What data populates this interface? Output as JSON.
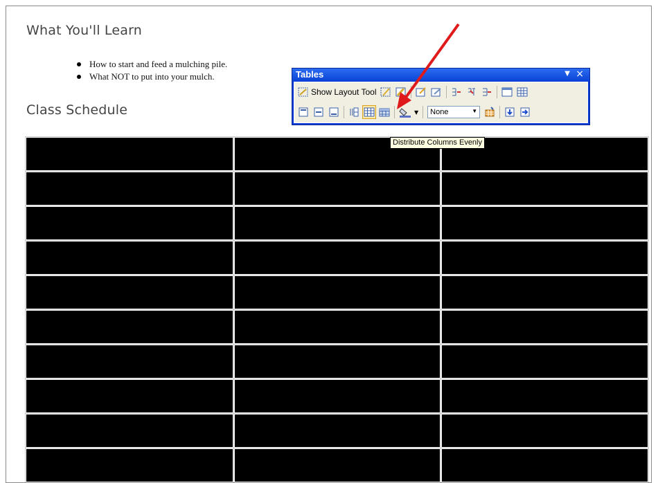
{
  "document": {
    "learn_heading": "What You'll Learn",
    "bullets": [
      "How to start and feed a mulching pile.",
      "What NOT to put into your mulch."
    ],
    "schedule_heading": "Class Schedule",
    "table": {
      "rows": 10,
      "columns": 3
    }
  },
  "toolbar": {
    "title": "Tables",
    "show_layout_tool_label": "Show Layout Tool",
    "style_dropdown_value": "None",
    "tooltip": "Distribute Columns Evenly"
  },
  "colors": {
    "toolbar_title": "#0b44d6",
    "toolbar_body": "#f1efe2",
    "table_cell": "#000000",
    "tooltip_bg": "#ffffe1",
    "annotation_arrow": "#e01a1a"
  },
  "icons": {
    "row1": [
      "draw-table-icon",
      "eraser-icon",
      "insert-table-icon",
      "cell-props-icon",
      "split-cells-icon",
      "merge-cells-icon",
      "insert-row-icon",
      "table-grid-icon"
    ],
    "row2": [
      "align-top-icon",
      "align-center-icon",
      "align-bottom-icon",
      "distribute-rows-icon",
      "distribute-columns-icon",
      "autofit-icon",
      "fill-color-icon",
      "table-autoformat-icon",
      "insert-rows-below-icon",
      "insert-columns-right-icon"
    ]
  }
}
